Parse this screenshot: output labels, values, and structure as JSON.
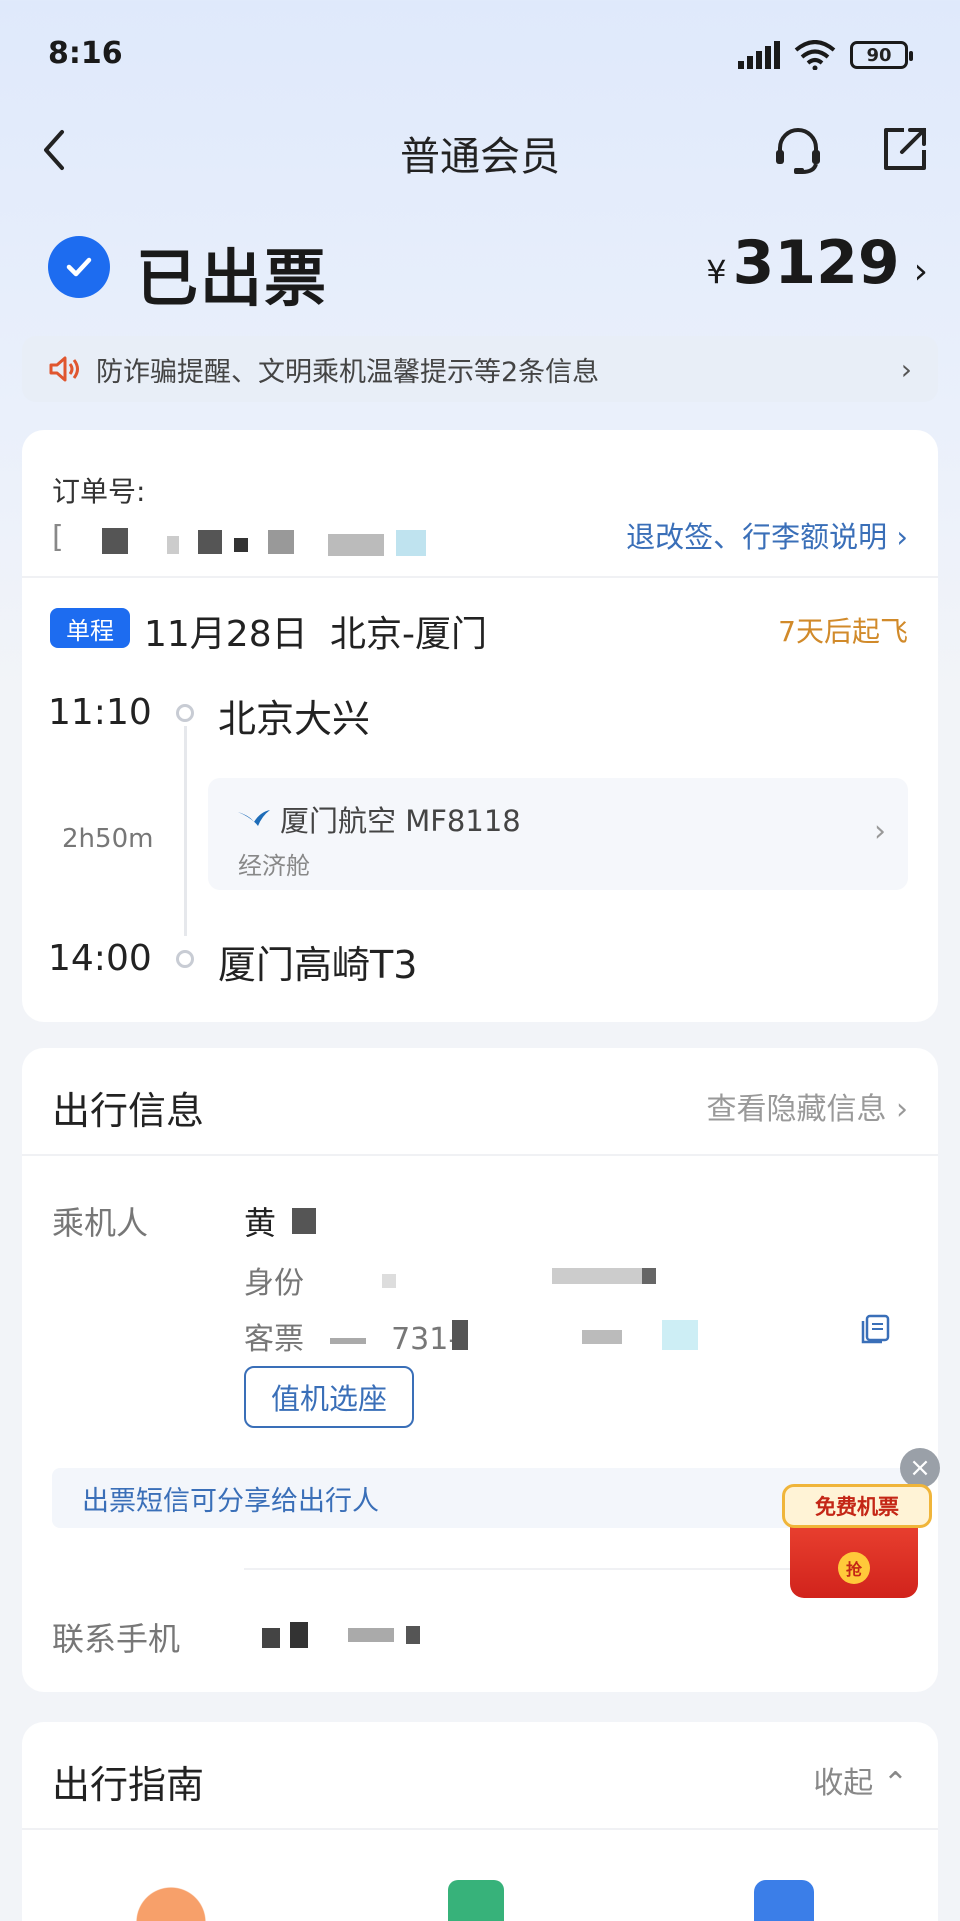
{
  "status_bar": {
    "time": "8:16",
    "battery": "90"
  },
  "nav": {
    "title": "普通会员",
    "back_icon": "back-chevron-icon",
    "service_icon": "headset-icon",
    "share_icon": "share-icon"
  },
  "order_status": {
    "text": "已出票",
    "currency": "¥",
    "price": "3129",
    "chevron": "›"
  },
  "notice": {
    "text": "防诈骗提醒、文明乘机温馨提示等2条信息",
    "chevron": "›"
  },
  "order": {
    "number_label": "订单号:",
    "number_value": "[",
    "rules_link": "退改签、行李额说明 ›",
    "trip_type": "单程",
    "date": "11月28日",
    "route": "北京-厦门",
    "countdown": "7天后起飞",
    "departure": {
      "time": "11:10",
      "airport": "北京大兴"
    },
    "arrival": {
      "time": "14:00",
      "airport": "厦门高崎T3"
    },
    "duration": "2h50m",
    "flight": {
      "airline": "厦门航空 MF8118",
      "cabin": "经济舱",
      "chevron": "›"
    }
  },
  "travel_info": {
    "title": "出行信息",
    "hidden_link": "查看隐藏信息 ›",
    "passenger_label": "乘机人",
    "passenger_name": "黄",
    "id_prefix": "身份",
    "ticket_prefix": "客票",
    "ticket_visible": "731-",
    "checkin_button": "值机选座",
    "share_tip": "出票短信可分享给出行人",
    "phone_label": "联系手机"
  },
  "promo": {
    "label": "免费机票",
    "coin": "抢",
    "close": "×"
  },
  "guide": {
    "title": "出行指南",
    "collapse": "收起 ⌃"
  },
  "colors": {
    "primary": "#1d6cf0",
    "link": "#3a6fb8",
    "warning": "#d18a2a"
  }
}
